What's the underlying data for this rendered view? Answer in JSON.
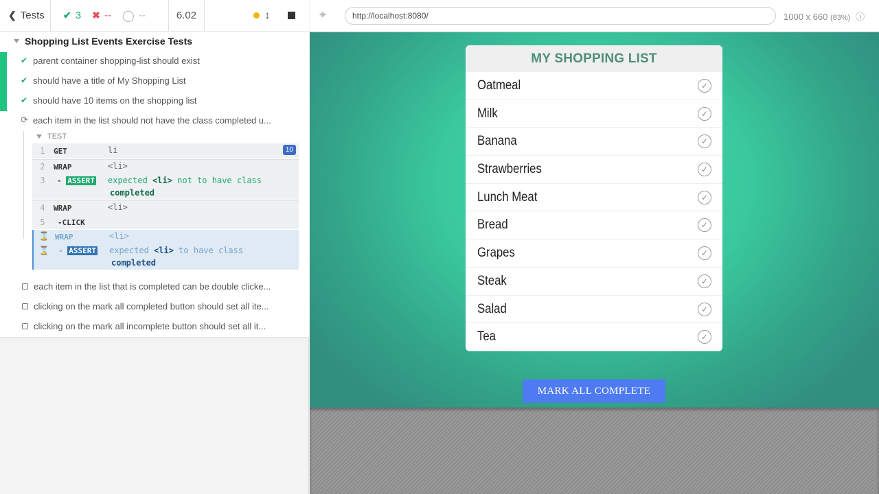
{
  "topbar": {
    "tests_label": "Tests",
    "passed": "3",
    "failed": "--",
    "pending": "--",
    "duration": "6.02"
  },
  "suite": {
    "title": "Shopping List Events Exercise Tests",
    "tests": [
      {
        "label": "parent container shopping-list should exist",
        "state": "passed"
      },
      {
        "label": "should have a title of My Shopping List",
        "state": "passed"
      },
      {
        "label": "should have 10 items on the shopping list",
        "state": "passed"
      },
      {
        "label": "each item in the list should not have the class completed u...",
        "state": "running"
      },
      {
        "label": "each item in the list that is completed can be double clicke...",
        "state": "pending"
      },
      {
        "label": "clicking on the mark all completed button should set all ite...",
        "state": "pending"
      },
      {
        "label": "clicking on the mark all incomplete button should set all it...",
        "state": "pending"
      }
    ],
    "test_section_label": "TEST",
    "commands": [
      {
        "num": "1",
        "name": "GET",
        "msg": "li",
        "count": "10"
      },
      {
        "num": "2",
        "name": "WRAP",
        "msg": "<li>"
      },
      {
        "num": "3",
        "name": "ASSERT",
        "msg_prefix": "expected",
        "msg_el": "<li>",
        "msg_mid": "not to have class",
        "msg_cls": "completed"
      },
      {
        "num": "4",
        "name": "WRAP",
        "msg": "<li>"
      },
      {
        "num": "5",
        "name": "-CLICK",
        "msg": ""
      },
      {
        "num": "",
        "name": "WRAP",
        "msg": "<li>"
      },
      {
        "num": "",
        "name": "ASSERT",
        "msg_prefix": "expected",
        "msg_el": "<li>",
        "msg_mid": "to have class",
        "msg_cls": "completed"
      }
    ]
  },
  "browser": {
    "url": "http://localhost:8080/",
    "viewport": "1000 x 660",
    "zoom": "(83%)"
  },
  "app": {
    "title": "MY SHOPPING LIST",
    "items": [
      "Oatmeal",
      "Milk",
      "Banana",
      "Strawberries",
      "Lunch Meat",
      "Bread",
      "Grapes",
      "Steak",
      "Salad",
      "Tea"
    ],
    "mark_all_label": "MARK ALL COMPLETE"
  },
  "colors": {
    "pass": "#1fa971",
    "fail": "#e94f5f",
    "app_green": "#3ac99e",
    "button_blue": "#4f7bf2",
    "title_green": "#4f8f7a"
  }
}
